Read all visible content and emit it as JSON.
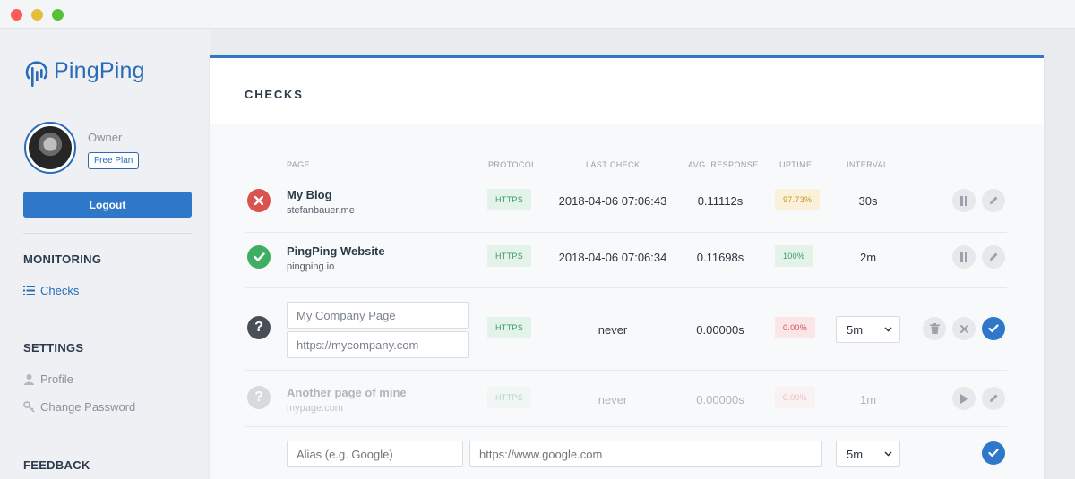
{
  "app": {
    "name": "PingPing"
  },
  "user": {
    "role": "Owner",
    "plan": "Free Plan"
  },
  "sidebar": {
    "logout_label": "Logout",
    "monitoring_head": "MONITORING",
    "checks_label": "Checks",
    "settings_head": "SETTINGS",
    "profile_label": "Profile",
    "change_password_label": "Change Password",
    "feedback_head": "FEEDBACK"
  },
  "main": {
    "title": "CHECKS",
    "columns": [
      "PAGE",
      "PROTOCOL",
      "LAST CHECK",
      "AVG. RESPONSE",
      "UPTIME",
      "INTERVAL"
    ],
    "rows": [
      {
        "name": "My Blog",
        "url": "stefanbauer.me",
        "protocol": "HTTPS",
        "last_check": "2018-04-06 07:06:43",
        "avg_response": "0.11112s",
        "uptime": "97.73%",
        "interval": "30s",
        "status": "down"
      },
      {
        "name": "PingPing Website",
        "url": "pingping.io",
        "protocol": "HTTPS",
        "last_check": "2018-04-06 07:06:34",
        "avg_response": "0.11698s",
        "uptime": "100%",
        "interval": "2m",
        "status": "up"
      },
      {
        "name_value": "My Company Page",
        "url_value": "https://mycompany.com",
        "protocol": "HTTPS",
        "last_check": "never",
        "avg_response": "0.00000s",
        "uptime": "0.00%",
        "interval": "5m",
        "status": "unknown"
      },
      {
        "name": "Another page of mine",
        "url": "mypage.com",
        "protocol": "HTTPS",
        "last_check": "never",
        "avg_response": "0.00000s",
        "uptime": "0.00%",
        "interval": "1m",
        "status": "paused"
      }
    ],
    "new_check": {
      "alias_placeholder": "Alias (e.g. Google)",
      "url_placeholder": "https://www.google.com",
      "interval": "5m"
    }
  },
  "colors": {
    "accent": "#2f78c9",
    "down": "#d9534f",
    "up": "#3dae62",
    "unknown": "#4a4f57"
  }
}
